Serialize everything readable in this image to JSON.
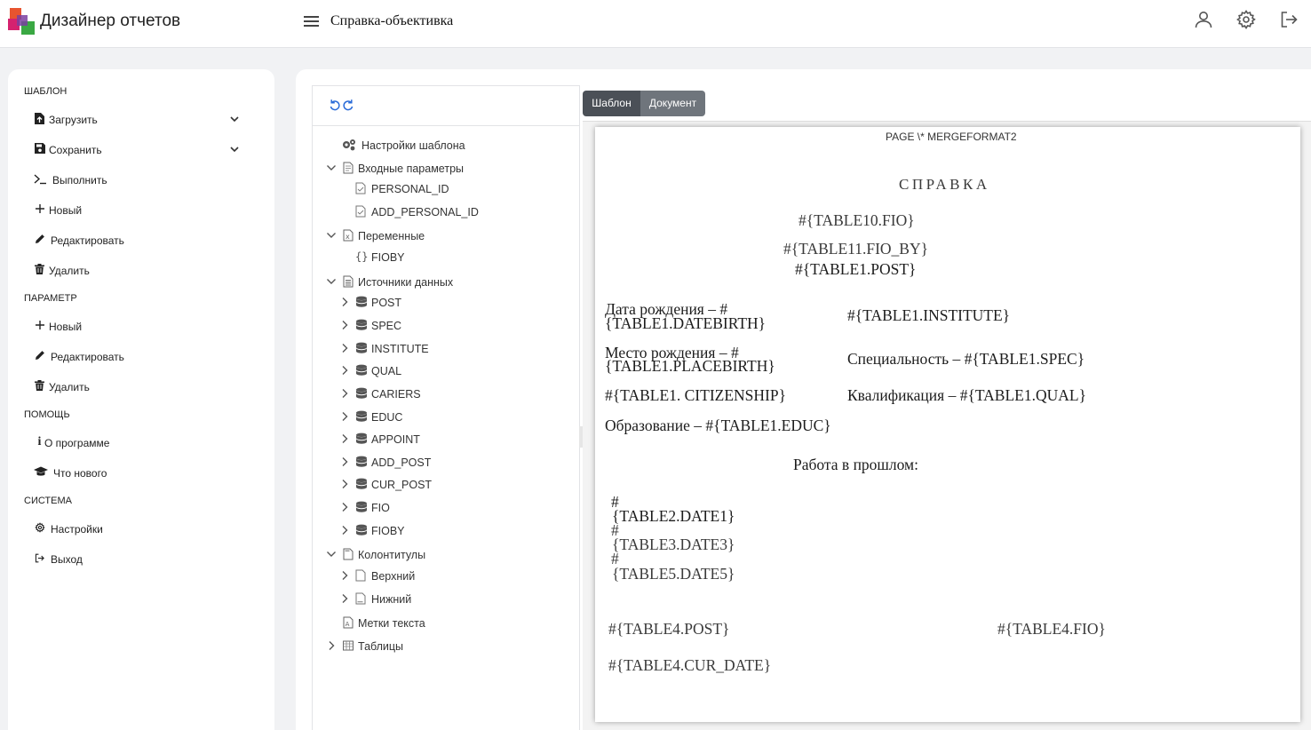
{
  "header": {
    "app_title": "Дизайнер отчетов",
    "document_title": "Справка-объективка",
    "logo_colors": [
      "#e8542f",
      "#d5226f",
      "#3aa843",
      "#7a3fa0"
    ]
  },
  "sidebar": {
    "sections": {
      "template": "ШАБЛОН",
      "parameter": "ПАРАМЕТР",
      "help": "ПОМОЩЬ",
      "system": "СИСТЕМА"
    },
    "template_items": [
      {
        "label": "Загрузить",
        "icon": "file-upload-icon"
      },
      {
        "label": "Сохранить",
        "icon": "save-icon"
      },
      {
        "label": "Выполнить",
        "icon": "terminal-icon"
      },
      {
        "label": "Новый",
        "icon": "plus-icon"
      },
      {
        "label": "Редактировать",
        "icon": "pencil-icon"
      },
      {
        "label": "Удалить",
        "icon": "trash-icon"
      }
    ],
    "parameter_items": [
      {
        "label": "Новый",
        "icon": "plus-icon"
      },
      {
        "label": "Редактировать",
        "icon": "pencil-icon"
      },
      {
        "label": "Удалить",
        "icon": "trash-icon"
      }
    ],
    "help_items": [
      {
        "label": "О программе",
        "icon": "info-icon"
      },
      {
        "label": "Что нового",
        "icon": "graduation-cap-icon"
      }
    ],
    "system_items": [
      {
        "label": "Настройки",
        "icon": "gear-icon"
      },
      {
        "label": "Выход",
        "icon": "logout-icon"
      }
    ]
  },
  "tree": {
    "settings": "Настройки шаблона",
    "input_params": "Входные параметры",
    "params": [
      "PERSONAL_ID",
      "ADD_PERSONAL_ID"
    ],
    "variables": "Переменные",
    "vars": [
      "FIOBY"
    ],
    "data_sources": "Источники данных",
    "sources": [
      "POST",
      "SPEC",
      "INSTITUTE",
      "QUAL",
      "CARIERS",
      "EDUC",
      "APPOINT",
      "ADD_POST",
      "CUR_POST",
      "FIO",
      "FIOBY"
    ],
    "headers_footers": "Колонтитулы",
    "hf": [
      "Верхний",
      "Нижний"
    ],
    "text_marks": "Метки текста",
    "tables": "Таблицы"
  },
  "tabs": {
    "template": "Шаблон",
    "document": "Документ"
  },
  "document": {
    "page_field": "PAGE \\* MERGEFORMAT2",
    "heading": "СПРАВКА",
    "fio": "#{TABLE10.FIO}",
    "fio_by": "#{TABLE11.FIO_BY}",
    "post": "#{TABLE1.POST}",
    "birth_date_1": "Дата рождения – #",
    "birth_date_2": "{TABLE1.DATEBIRTH}",
    "institute": "#{TABLE1.INSTITUTE}",
    "birth_place_1": "Место рождения – #",
    "birth_place_2": "{TABLE1.PLACEBIRTH}",
    "spec": "Специальность – #{TABLE1.SPEC}",
    "citizenship": "#{TABLE1. CITIZENSHIP}",
    "qual": "Квалификация – #{TABLE1.QUAL}",
    "educ": "Образование – #{TABLE1.EDUC}",
    "work_past": "Работа в прошлом:",
    "hash": "#",
    "date1": "{TABLE2.DATE1}",
    "date3": "{TABLE3.DATE3}",
    "date5": "{TABLE5.DATE5}",
    "t4_post": "#{TABLE4.POST}",
    "t4_fio": "#{TABLE4.FIO}",
    "t4_cur_date": "#{TABLE4.CUR_DATE}"
  }
}
